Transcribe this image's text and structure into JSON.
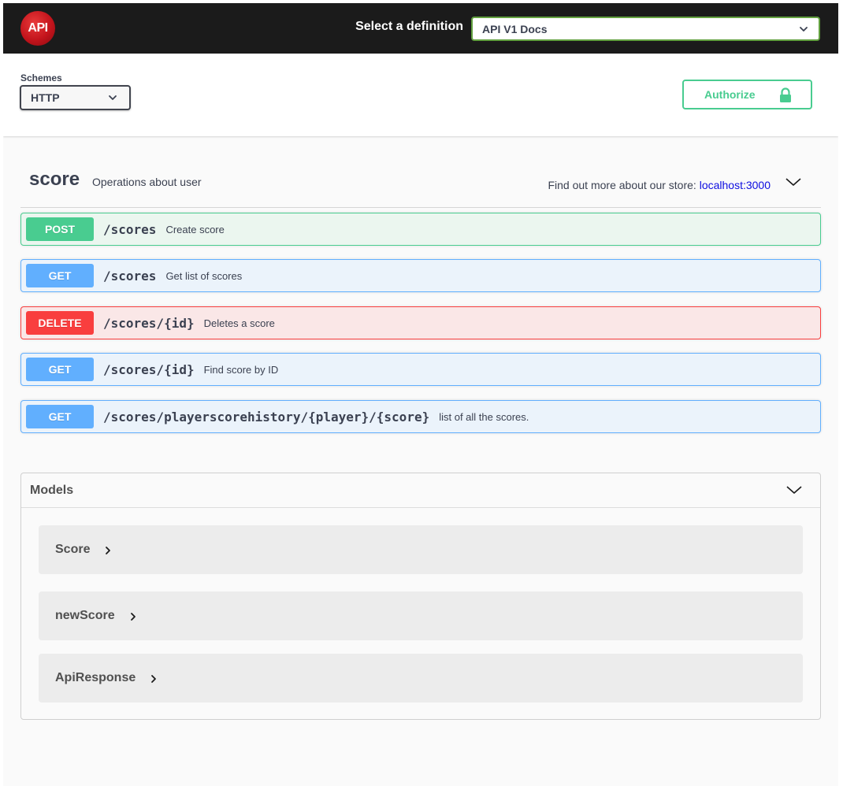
{
  "topbar": {
    "logo_text": "API",
    "definition_label": "Select a definition",
    "definition_selected": "API V1 Docs"
  },
  "schemes": {
    "label": "Schemes",
    "selected": "HTTP"
  },
  "authorize": {
    "label": "Authorize"
  },
  "tag": {
    "name": "score",
    "description": "Operations about user",
    "external_prefix": "Find out more about our store:",
    "external_link": "localhost:3000"
  },
  "operations": [
    {
      "method": "POST",
      "path": "/scores",
      "summary": "Create score"
    },
    {
      "method": "GET",
      "path": "/scores",
      "summary": "Get list of scores"
    },
    {
      "method": "DELETE",
      "path": "/scores/{id}",
      "summary": "Deletes a score"
    },
    {
      "method": "GET",
      "path": "/scores/{id}",
      "summary": "Find score by ID"
    },
    {
      "method": "GET",
      "path": "/scores/playerscorehistory/{player}/{score}",
      "summary": "list of all the scores."
    }
  ],
  "models": {
    "title": "Models",
    "items": [
      {
        "name": "Score"
      },
      {
        "name": "newScore"
      },
      {
        "name": "ApiResponse"
      }
    ]
  },
  "colors": {
    "post": "#49cc90",
    "get": "#61affe",
    "delete": "#f93e3e",
    "topbar": "#1b1b1b",
    "select_border": "#62a03f"
  }
}
